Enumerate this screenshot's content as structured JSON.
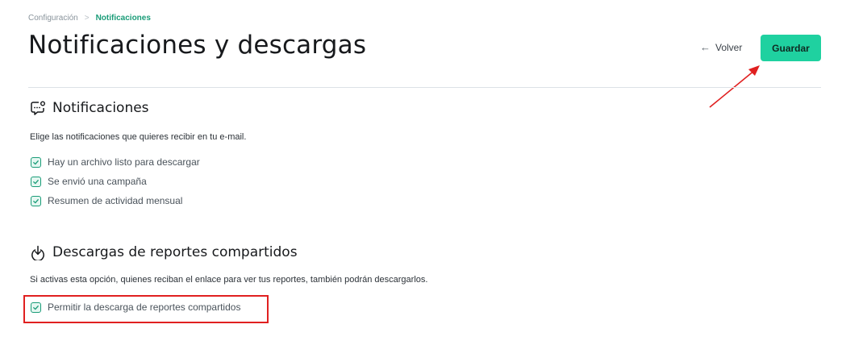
{
  "breadcrumb": {
    "parent": "Configuración",
    "separator": ">",
    "current": "Notificaciones"
  },
  "page_title": "Notificaciones y descargas",
  "header": {
    "back_label": "Volver",
    "back_icon": "arrow-left-icon",
    "save_label": "Guardar"
  },
  "notifications": {
    "icon": "chat-bubble-notification-icon",
    "title": "Notificaciones",
    "description": "Elige las notificaciones que quieres recibir en tu e-mail.",
    "items": [
      {
        "label": "Hay un archivo listo para descargar",
        "checked": true
      },
      {
        "label": "Se envió una campaña",
        "checked": true
      },
      {
        "label": "Resumen de actividad mensual",
        "checked": true
      }
    ]
  },
  "downloads": {
    "icon": "download-icon",
    "title": "Descargas de reportes compartidos",
    "description": "Si activas esta opción, quienes reciban el enlace para ver tus reportes, también podrán descargarlos.",
    "items": [
      {
        "label": "Permitir la descarga de reportes compartidos",
        "checked": true
      }
    ]
  },
  "colors": {
    "accent": "#1fd1a0",
    "check": "#1a9c78",
    "annotation": "#e02020"
  }
}
